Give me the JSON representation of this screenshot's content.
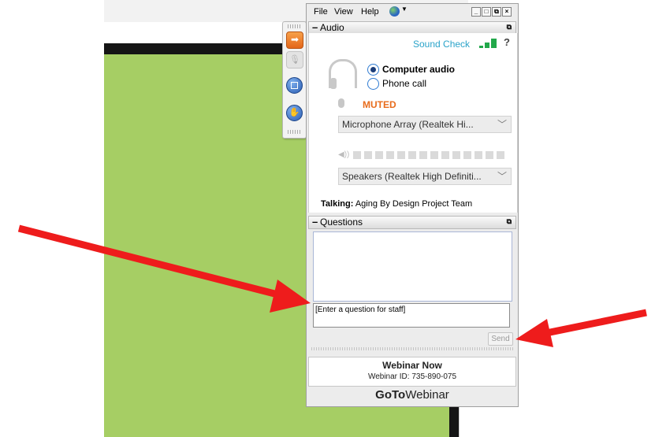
{
  "menu": {
    "file": "File",
    "view": "View",
    "help": "Help",
    "globe_icon": "globe-icon"
  },
  "window_controls": {
    "minimize": "_",
    "restore": "□",
    "popout": "⧉",
    "close": "×"
  },
  "audio": {
    "section_title": "Audio",
    "sound_check": "Sound Check",
    "help": "?",
    "computer_audio": "Computer audio",
    "phone_call": "Phone call",
    "selected": "Computer audio",
    "muted": "MUTED",
    "microphone": "Microphone Array (Realtek Hi...",
    "speakers": "Speakers (Realtek High Definiti...",
    "talking_label": "Talking:",
    "talking_value": "Aging By Design  Project Team"
  },
  "questions": {
    "section_title": "Questions",
    "input_placeholder": "[Enter a question for staff]",
    "send": "Send"
  },
  "webinar": {
    "title": "Webinar Now",
    "id_text": "Webinar ID: 735-890-075"
  },
  "logo": {
    "bold": "GoTo",
    "rest": "Webinar"
  },
  "colors": {
    "green_screen": "#a6ce64",
    "muted_orange": "#e86c1c",
    "sound_check_blue": "#2aa3c9",
    "arrow_red": "#ee1c1c"
  }
}
